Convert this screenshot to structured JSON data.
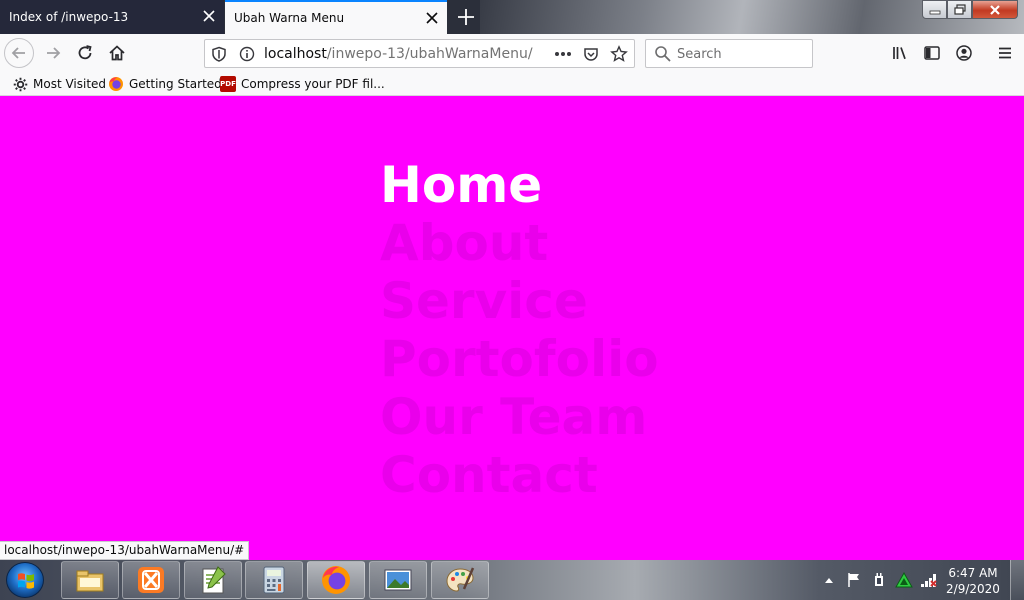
{
  "browser": {
    "tabs": [
      {
        "title": "Index of /inwepo-13",
        "active": false
      },
      {
        "title": "Ubah Warna Menu",
        "active": true
      }
    ],
    "url_host": "localhost",
    "url_path": "/inwepo-13/ubahWarnaMenu/",
    "search_placeholder": "Search",
    "bookmarks": [
      "Most Visited",
      "Getting Started",
      "Compress your PDF fil..."
    ],
    "pdf_badge": "PDF",
    "status_url": "localhost/inwepo-13/ubahWarnaMenu/#"
  },
  "page": {
    "background_color": "#ff00ff",
    "active_color": "#ffffff",
    "menu": [
      "Home",
      "About",
      "Service",
      "Portofolio",
      "Our Team",
      "Contact"
    ],
    "active_index": 0
  },
  "taskbar": {
    "time": "6:47 AM",
    "date": "2/9/2020",
    "apps": [
      "file-explorer-icon",
      "xampp-icon",
      "notepad-plus-plus-icon",
      "calculator-icon",
      "firefox-icon",
      "photo-viewer-icon",
      "paint-icon"
    ]
  }
}
